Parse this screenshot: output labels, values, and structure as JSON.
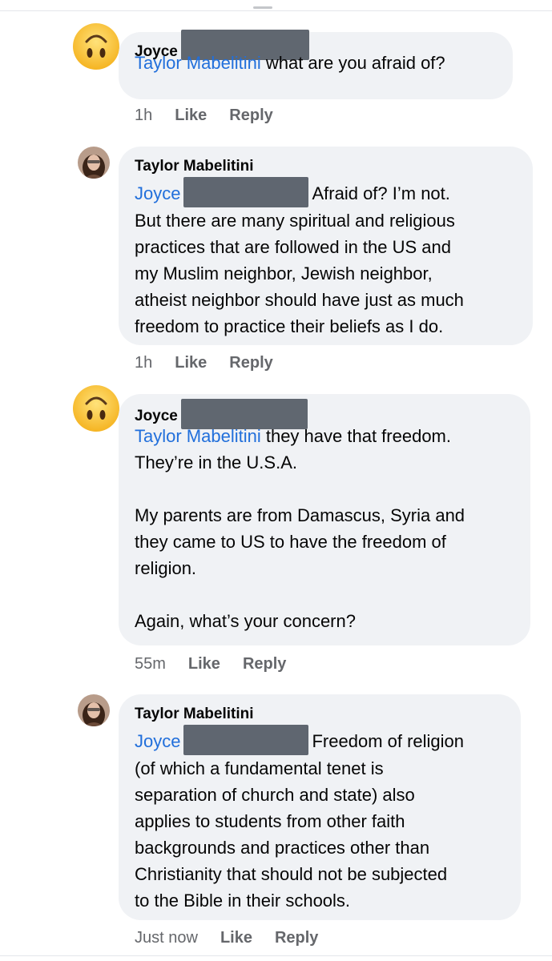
{
  "comments": [
    {
      "author": "Joyce",
      "mention": "Taylor Mabelitini",
      "text": " what are you afraid of?",
      "time": "1h",
      "like": "Like",
      "reply": "Reply"
    },
    {
      "author": "Taylor Mabelitini",
      "mention": "Joyce",
      "lines": [
        "Afraid of? I’m not.",
        "But there are many spiritual and religious",
        "practices that are followed in the US and",
        "my Muslim neighbor, Jewish neighbor,",
        "atheist neighbor should have just as much",
        "freedom to practice their beliefs as I do."
      ],
      "time": "1h",
      "like": "Like",
      "reply": "Reply"
    },
    {
      "author": "Joyce",
      "mention": "Taylor Mabelitini",
      "lines": [
        " they have that freedom.",
        "They’re in the U.S.A.",
        "",
        "My parents are from Damascus, Syria and",
        "they came to US to have the freedom of",
        "religion.",
        "",
        "Again, what’s your concern?"
      ],
      "time": "55m",
      "like": "Like",
      "reply": "Reply"
    },
    {
      "author": "Taylor Mabelitini",
      "mention": "Joyce",
      "lines": [
        "Freedom of religion",
        "(of which a fundamental tenet is",
        "separation of church and state) also",
        "applies to students from other faith",
        "backgrounds and practices other than",
        "Christianity that should not be subjected",
        "to the Bible in their schools."
      ],
      "time": "Just now",
      "like": "Like",
      "reply": "Reply"
    }
  ],
  "colors": {
    "bubble": "#f0f2f5",
    "mention": "#216fdb",
    "meta": "#65676b",
    "redaction": "#5f6670"
  },
  "icons": {
    "joyce_avatar": "upside-down-face-emoji-icon",
    "taylor_avatar": "profile-photo"
  }
}
